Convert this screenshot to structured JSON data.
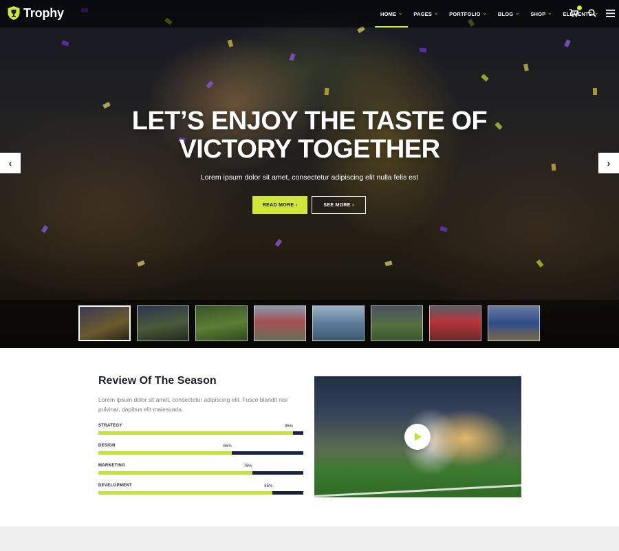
{
  "brand": {
    "name": "Trophy",
    "accent_color": "#cfe63b",
    "dark_color": "#1b2240"
  },
  "nav": {
    "items": [
      {
        "label": "HOME",
        "active": true
      },
      {
        "label": "PAGES",
        "active": false
      },
      {
        "label": "PORTFOLIO",
        "active": false
      },
      {
        "label": "BLOG",
        "active": false
      },
      {
        "label": "SHOP",
        "active": false
      },
      {
        "label": "ELEMENTS",
        "active": false
      }
    ],
    "icons": [
      "cart-icon",
      "search-icon",
      "menu-icon"
    ]
  },
  "hero": {
    "title_line1": "LET’S ENJOY THE TASTE OF",
    "title_line2": "VICTORY TOGETHER",
    "subtitle": "Lorem ipsum dolor sit amet, consectetur adipiscing elit nulla felis est",
    "read_more": "READ MORE",
    "see_more": "SEE MORE",
    "thumbnail_count": 8
  },
  "review": {
    "title": "Review Of The Season",
    "text": "Lorem ipsum dolor sit amet, consectetur adipiscing elit. Fusce blandit nisi pulvinar, dapibus elit malesuada.",
    "skills": [
      {
        "label": "STRATEGY",
        "value": 95,
        "value_label": "95%"
      },
      {
        "label": "DESIGN",
        "value": 65,
        "value_label": "65%"
      },
      {
        "label": "MARKETING",
        "value": 75,
        "value_label": "75%"
      },
      {
        "label": "DEVELOPMENT",
        "value": 85,
        "value_label": "85%"
      }
    ]
  }
}
